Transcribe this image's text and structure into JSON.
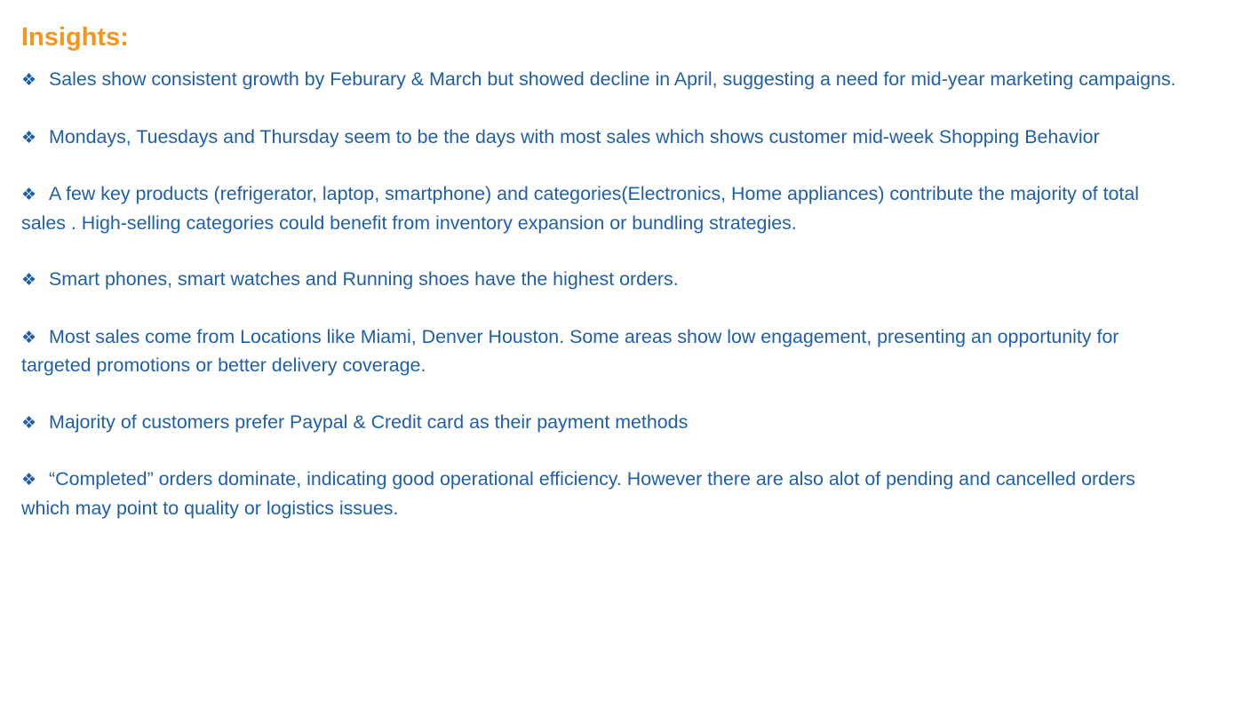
{
  "title": "Insights:",
  "colors": {
    "title": "#f7941d",
    "body_text": "#1f5fa8",
    "background": "#ffffff"
  },
  "bullet_icon": "diamond-bullet-icon",
  "bullet_glyph": "❖",
  "insights": [
    "Sales show consistent growth by Feburary & March but showed decline in April, suggesting a need for mid-year marketing campaigns.",
    "Mondays, Tuesdays and Thursday seem to be the days with most sales which shows customer mid-week Shopping Behavior",
    "A few key products (refrigerator, laptop, smartphone) and categories(Electronics, Home appliances) contribute the majority of total sales . High-selling categories could benefit from inventory expansion or bundling strategies.",
    "Smart phones, smart watches and Running shoes have the highest orders.",
    "Most sales come from Locations like Miami, Denver Houston. Some areas show low engagement, presenting an opportunity for targeted promotions or better delivery coverage.",
    "Majority of customers prefer Paypal  & Credit card as their payment methods",
    "“Completed” orders dominate, indicating good operational efficiency. However there are also alot of pending and cancelled orders which may point to quality or logistics issues."
  ]
}
